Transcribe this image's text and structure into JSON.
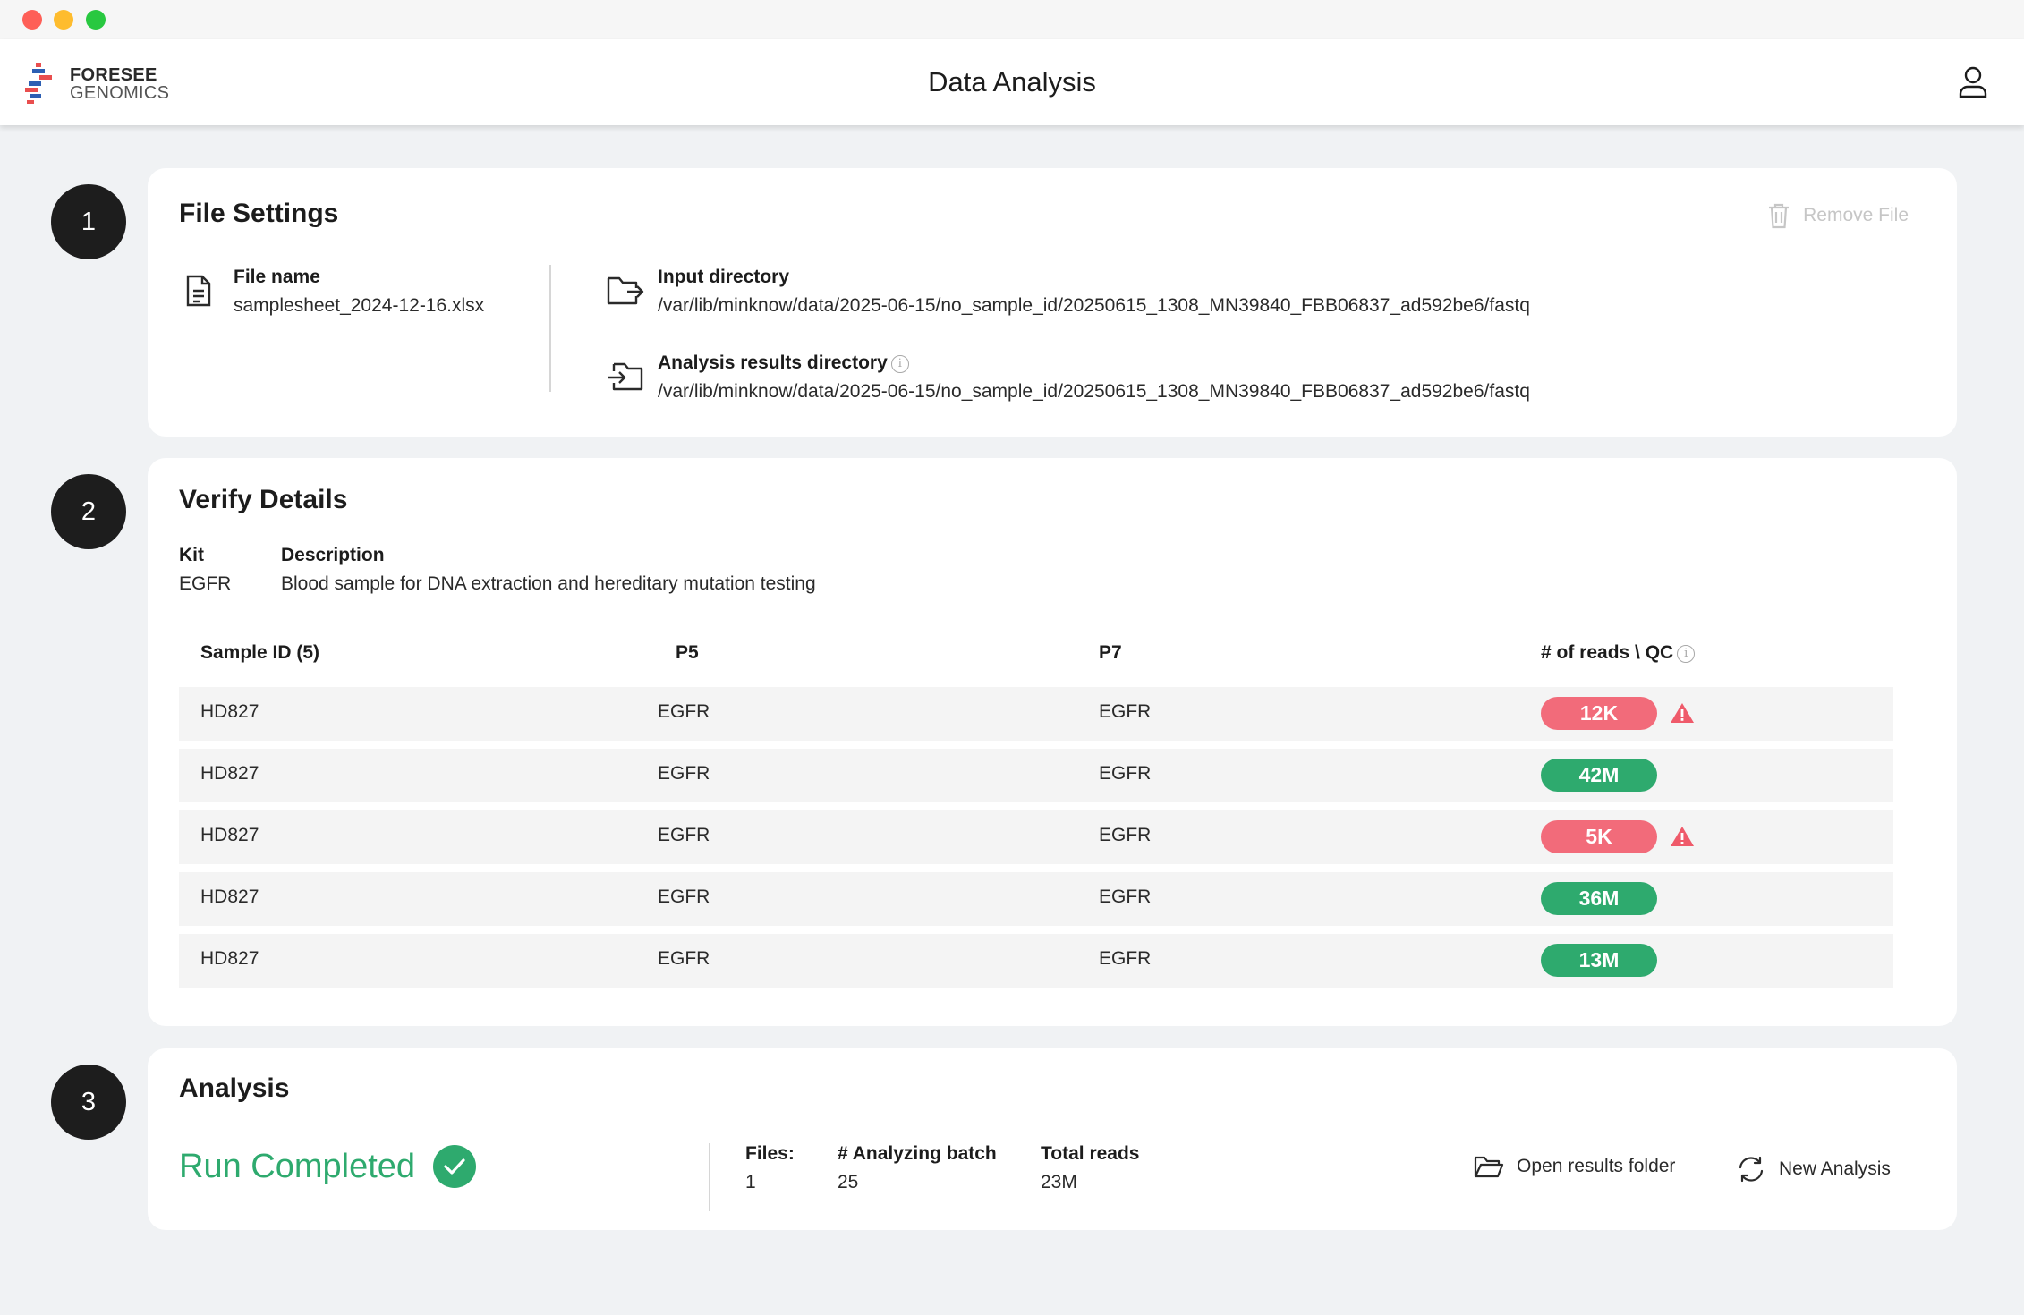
{
  "app": {
    "logo_line1": "FORESEE",
    "logo_line2": "GENOMICS",
    "title": "Data Analysis"
  },
  "steps": [
    "1",
    "2",
    "3"
  ],
  "file_settings": {
    "title": "File Settings",
    "remove_label": "Remove File",
    "file_name_label": "File name",
    "file_name": "samplesheet_2024-12-16.xlsx",
    "input_dir_label": "Input directory",
    "input_dir": "/var/lib/minknow/data/2025-06-15/no_sample_id/20250615_1308_MN39840_FBB06837_ad592be6/fastq",
    "results_dir_label": "Analysis results directory",
    "results_dir": "/var/lib/minknow/data/2025-06-15/no_sample_id/20250615_1308_MN39840_FBB06837_ad592be6/fastq"
  },
  "verify": {
    "title": "Verify Details",
    "kit_label": "Kit",
    "kit": "EGFR",
    "description_label": "Description",
    "description": "Blood sample for DNA extraction and hereditary mutation testing",
    "columns": [
      "Sample ID (5)",
      "P5",
      "P7",
      "# of reads \\ QC"
    ],
    "rows": [
      {
        "sample_id": "HD827",
        "p5": "EGFR",
        "p7": "EGFR",
        "reads": "12K",
        "status": "fail"
      },
      {
        "sample_id": "HD827",
        "p5": "EGFR",
        "p7": "EGFR",
        "reads": "42M",
        "status": "pass"
      },
      {
        "sample_id": "HD827",
        "p5": "EGFR",
        "p7": "EGFR",
        "reads": "5K",
        "status": "fail"
      },
      {
        "sample_id": "HD827",
        "p5": "EGFR",
        "p7": "EGFR",
        "reads": "36M",
        "status": "pass"
      },
      {
        "sample_id": "HD827",
        "p5": "EGFR",
        "p7": "EGFR",
        "reads": "13M",
        "status": "pass"
      }
    ]
  },
  "analysis": {
    "title": "Analysis",
    "status": "Run Completed",
    "files_label": "Files:",
    "files": "1",
    "batch_label": "# Analyzing batch",
    "batch": "25",
    "total_reads_label": "Total reads",
    "total_reads": "23M",
    "open_folder_label": "Open results folder",
    "new_analysis_label": "New Analysis"
  },
  "colors": {
    "pass": "#2eaa6e",
    "fail": "#f26b7a",
    "warning_icon": "#ef5a6a"
  },
  "icons": [
    "user-icon",
    "trash-icon",
    "file-icon",
    "folder-export-icon",
    "folder-import-icon",
    "info-icon",
    "warning-icon",
    "check-icon",
    "folder-open-icon",
    "refresh-icon"
  ]
}
